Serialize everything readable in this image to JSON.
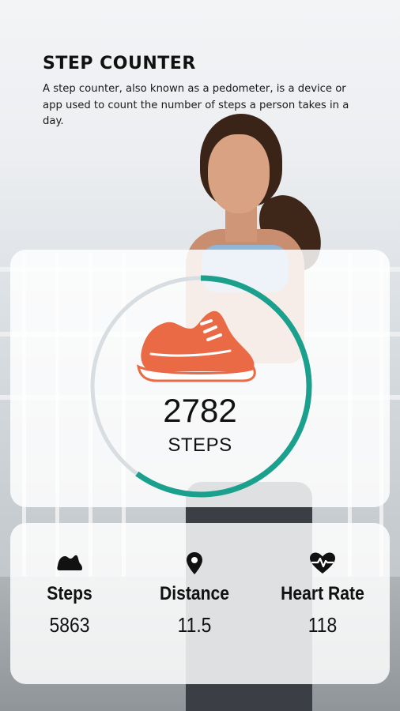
{
  "header": {
    "title": "STEP COUNTER",
    "description": "A step counter, also known as a pedometer, is a device or app used to count the number of steps a person takes in a day."
  },
  "progress": {
    "count": "2782",
    "label": "STEPS",
    "fraction": 0.6,
    "shoe_icon": "sneaker-icon",
    "colors": {
      "ring": "#1aa08c",
      "track": "#d8dde2",
      "shoe": "#ea6a45"
    }
  },
  "stats": [
    {
      "icon": "shoe-icon",
      "label": "Steps",
      "value": "5863"
    },
    {
      "icon": "location-pin-icon",
      "label": "Distance",
      "value": "11.5"
    },
    {
      "icon": "heart-rate-icon",
      "label": "Heart Rate",
      "value": "118"
    }
  ]
}
